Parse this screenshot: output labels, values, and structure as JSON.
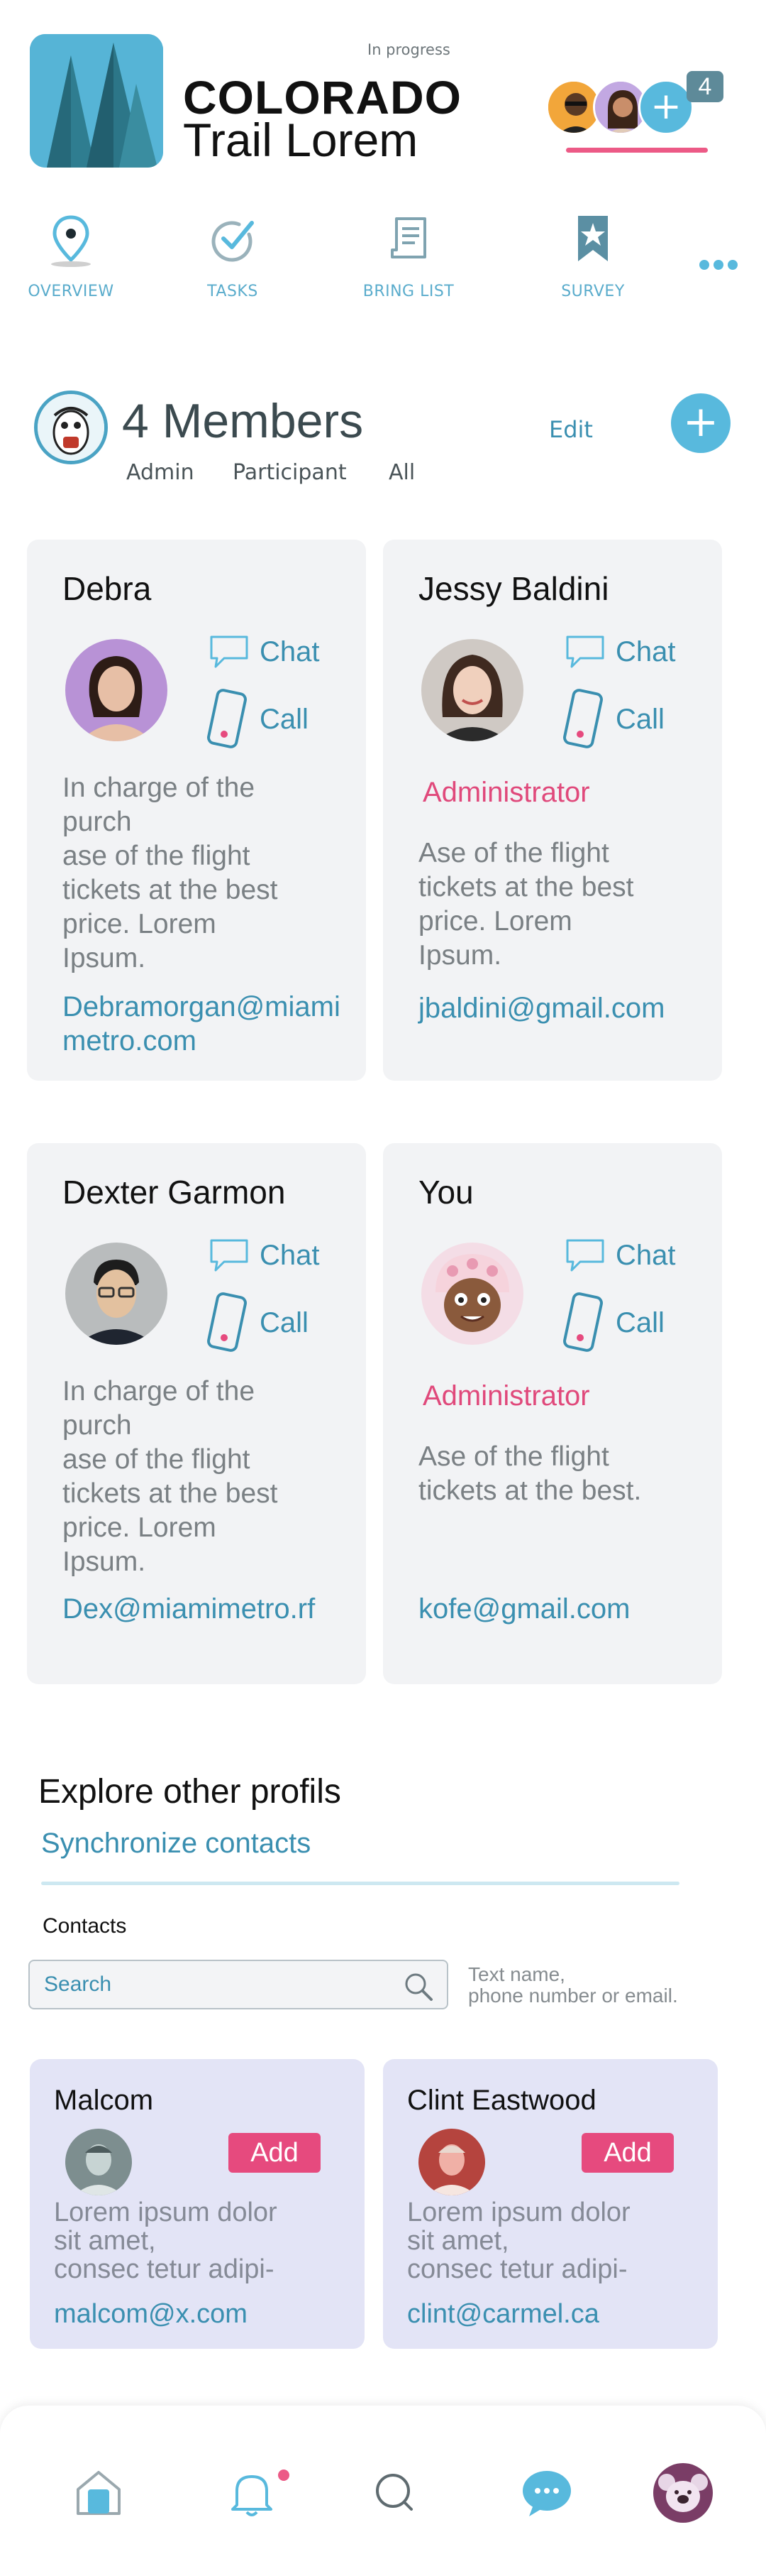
{
  "trip": {
    "status": "In progress",
    "title": "COLORADO",
    "subtitle": "Trail Lorem",
    "extra_count": "4",
    "image_icon": "pine-trees-icon"
  },
  "tabs": [
    {
      "label": "OVERVIEW",
      "icon": "map-pin-icon",
      "active": true
    },
    {
      "label": "TASKS",
      "icon": "checkmark-circle-icon"
    },
    {
      "label": "BRING LIST",
      "icon": "document-list-icon"
    },
    {
      "label": "SURVEY",
      "icon": "bookmark-star-icon"
    }
  ],
  "members_section": {
    "title": "4 Members",
    "edit_label": "Edit",
    "filters": [
      "Admin",
      "Participant",
      "All"
    ]
  },
  "members": [
    {
      "name": "Debra",
      "chat_label": "Chat",
      "call_label": "Call",
      "role": "",
      "description": "In charge of the\npurch\nase of  the flight\ntickets at the best\nprice. Lorem\nIpsum.",
      "email": "Debramorgan@miamimetro.com"
    },
    {
      "name": "Jessy Baldini",
      "chat_label": "Chat",
      "call_label": "Call",
      "role": "Administrator",
      "description": "Ase of  the flight\ntickets at the best\nprice. Lorem\nIpsum.",
      "email": "jbaldini@gmail.com"
    },
    {
      "name": "Dexter Garmon",
      "chat_label": "Chat",
      "call_label": "Call",
      "role": "",
      "description": "In charge of the\npurch\nase of  the flight\ntickets at the best\nprice. Lorem\nIpsum.",
      "email": "Dex@miamimetro.rf"
    },
    {
      "name": "You",
      "chat_label": "Chat",
      "call_label": "Call",
      "role": "Administrator",
      "description": "Ase of  the flight\ntickets at the best.",
      "email": "kofe@gmail.com"
    }
  ],
  "explore": {
    "title": "Explore other profils",
    "sync_label": "Synchronize contacts",
    "contacts_label": "Contacts",
    "search_placeholder": "Search",
    "search_hint": "Text name,\nphone number or email."
  },
  "contacts": [
    {
      "name": "Malcom",
      "add_label": "Add",
      "description": "Lorem ipsum dolor\nsit amet,\nconsec tetur adipi-",
      "email": "malcom@x.com"
    },
    {
      "name": "Clint Eastwood",
      "add_label": "Add",
      "description": "Lorem ipsum dolor\nsit amet,\nconsec tetur adipi-",
      "email": "clint@carmel.ca"
    }
  ],
  "bottom_nav": [
    {
      "icon": "home-icon"
    },
    {
      "icon": "bell-icon",
      "has_notification": true
    },
    {
      "icon": "search-icon"
    },
    {
      "icon": "chat-bubble-icon"
    },
    {
      "icon": "profile-avatar-icon"
    }
  ],
  "colors": {
    "accent": "#58b9dd",
    "link": "#3a8fb0",
    "highlight": "#e64a7e",
    "card_bg": "#f2f3f5",
    "contact_card_bg": "#e3e4f6"
  }
}
